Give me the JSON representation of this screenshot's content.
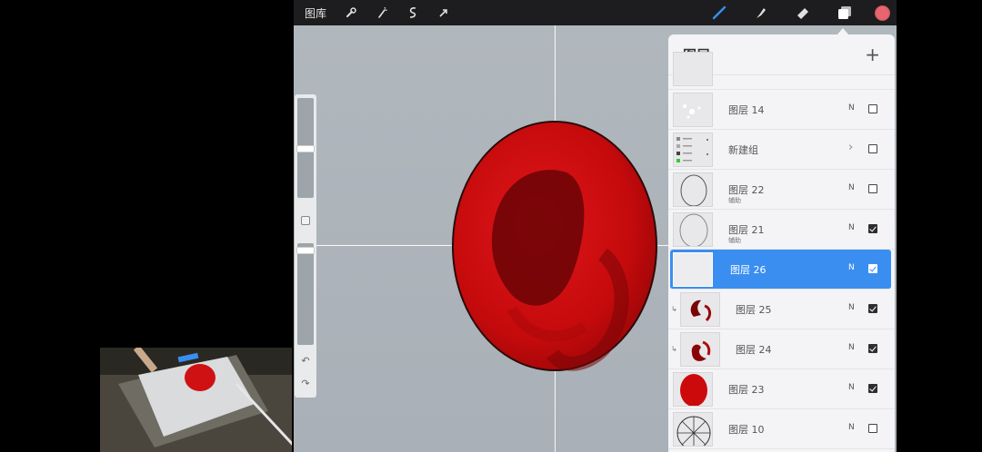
{
  "toolbar": {
    "gallery_label": "图库",
    "left_icons": [
      "wrench-icon",
      "magic-wand-icon",
      "selection-icon",
      "transform-arrow-icon"
    ],
    "right_icons": [
      "brush-icon",
      "smudge-icon",
      "eraser-icon",
      "layers-icon"
    ],
    "current_color": "#e8646e"
  },
  "sidebar": {
    "undo_glyph": "↶",
    "redo_glyph": "↷"
  },
  "canvas": {
    "ellipse_fill": "#c40a0c",
    "ellipse_shadow": "#6a0406"
  },
  "layers_panel": {
    "title": "图层",
    "add_glyph": "+",
    "layers": [
      {
        "name": "图层 14",
        "blend": "N",
        "visible": false,
        "type": "layer"
      },
      {
        "name": "新建组",
        "blend": "",
        "visible": false,
        "type": "group"
      },
      {
        "name": "图层 22",
        "sub": "辅助",
        "blend": "N",
        "visible": false,
        "type": "layer"
      },
      {
        "name": "图层 21",
        "sub": "辅助",
        "blend": "N",
        "visible": true,
        "type": "layer"
      },
      {
        "name": "图层 26",
        "blend": "N",
        "visible": true,
        "type": "layer",
        "selected": true
      },
      {
        "name": "图层 25",
        "blend": "N",
        "visible": true,
        "type": "clipped"
      },
      {
        "name": "图层 24",
        "blend": "N",
        "visible": true,
        "type": "clipped"
      },
      {
        "name": "图层 23",
        "blend": "N",
        "visible": true,
        "type": "layer"
      },
      {
        "name": "图层 10",
        "blend": "N",
        "visible": false,
        "type": "layer"
      }
    ]
  }
}
